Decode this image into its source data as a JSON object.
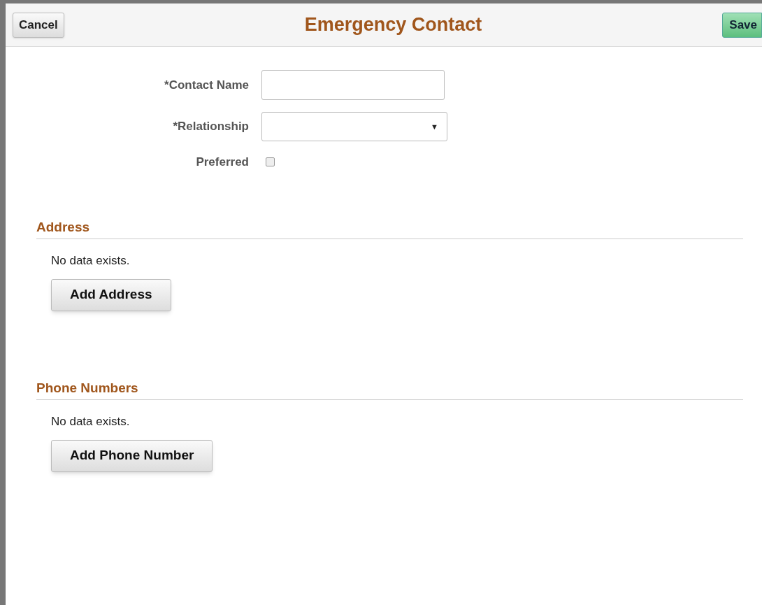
{
  "header": {
    "cancel": "Cancel",
    "title": "Emergency Contact",
    "save": "Save"
  },
  "fields": [
    {
      "kind": "text",
      "label": "*Contact Name"
    },
    {
      "kind": "select",
      "label": "*Relationship",
      "caret": "▼"
    },
    {
      "kind": "checkbox",
      "label": "Preferred",
      "checked": false
    }
  ],
  "sections": [
    {
      "title": "Address",
      "empty_text": "No data exists.",
      "button": "Add Address"
    },
    {
      "title": "Phone Numbers",
      "empty_text": "No data exists.",
      "button": "Add Phone Number"
    }
  ]
}
